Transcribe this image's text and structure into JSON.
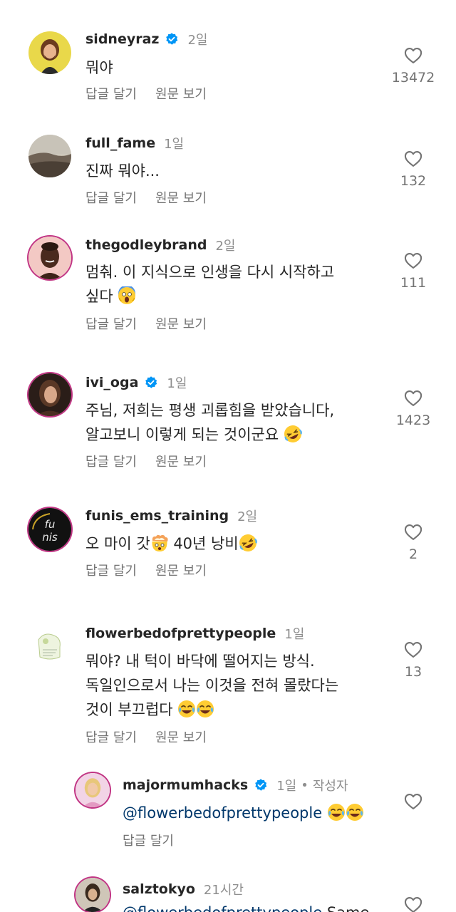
{
  "labels": {
    "reply": "답글 달기",
    "see_original": "원문 보기",
    "author_tag": "작성자",
    "separator": "•"
  },
  "comments": [
    {
      "username": "sidneyraz",
      "verified": true,
      "time": "2일",
      "text": "뭐야",
      "likes": "13472"
    },
    {
      "username": "full_fame",
      "verified": false,
      "time": "1일",
      "text": "진짜 뭐야...",
      "likes": "132"
    },
    {
      "username": "thegodleybrand",
      "verified": false,
      "time": "2일",
      "text_line1": "멈춰. 이 지식으로 인생을 다시 시작하고",
      "text_line2": "싶다",
      "emoji": "face-screaming-emoji",
      "likes": "111"
    },
    {
      "username": "ivi_oga",
      "verified": true,
      "time": "1일",
      "text_line1": "주님, 저희는 평생 괴롭힘을 받았습니다,",
      "text_line2": "알고보니 이렇게 되는 것이군요",
      "emoji": "rolling-laughing-emoji",
      "likes": "1423"
    },
    {
      "username": "funis_ems_training",
      "verified": false,
      "time": "2일",
      "text_part1": "오 마이 갓",
      "text_part2": " 40년 낭비",
      "emoji1": "exploding-head-emoji",
      "emoji2": "rolling-laughing-emoji",
      "likes": "2",
      "avatar_text": "fu nis"
    },
    {
      "username": "flowerbedofprettypeople",
      "verified": false,
      "time": "1일",
      "text_line1": "뭐야? 내 턱이 바닥에 떨어지는 방식.",
      "text_line2": "독일인으로서 나는 이것을 전혀 몰랐다는",
      "text_line3": "것이 부끄럽다",
      "emoji": "tears-of-joy-emoji",
      "likes": "13"
    }
  ],
  "replies": [
    {
      "username": "majormumhacks",
      "verified": true,
      "time": "1일",
      "mention": "@flowerbedofprettypeople",
      "emoji": "tears-of-joy-emoji"
    },
    {
      "username": "salztokyo",
      "verified": false,
      "time": "21시간",
      "mention": "@flowerbedofprettypeople",
      "text": " Same"
    }
  ],
  "colors": {
    "text": "#262626",
    "muted": "#737373",
    "time": "#8e8e8e",
    "verified": "#0095f6",
    "mention": "#00376b",
    "story_ring": "#c13584"
  }
}
